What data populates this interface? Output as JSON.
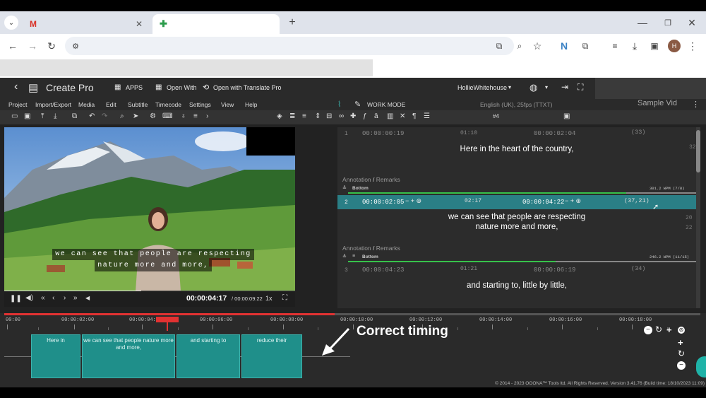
{
  "browser": {
    "tabs": [
      {
        "icon": "gmail-icon",
        "label": ""
      },
      {
        "icon": "ooona-icon",
        "label": ""
      }
    ],
    "new_tab": "+",
    "url": ""
  },
  "app": {
    "back": "‹",
    "title": "Create Pro",
    "apps_label": "APPS",
    "open_with_label": "Open With",
    "translate_label": "Open with Translate Pro",
    "user": "HollieWhitehouse",
    "work_mode": "WORK MODE",
    "format_info": "English (UK), 25fps (TTXT)",
    "sample_vid": "Sample Vid",
    "subtitle_counter": "#4",
    "menu": [
      "Project",
      "Import/Export",
      "Media",
      "Edit",
      "Subtitle",
      "Timecode",
      "Settings",
      "View",
      "Help"
    ]
  },
  "video": {
    "subtitle_line1": "we can see that people are respecting",
    "subtitle_line2": "nature more and more,",
    "current_time": "00:00:04:17",
    "duration": "/ 00:00:09:22",
    "speed": "1x",
    "progress": 0.47
  },
  "subtitles": [
    {
      "num": "1",
      "in": "00:00:00:19",
      "dur": "01:10",
      "out": "00:00:02:04",
      "chars": "(33)",
      "cps": "32",
      "text1": "Here in the heart of the country,",
      "text2": ""
    },
    {
      "num": "2",
      "in": "00:00:02:05",
      "dur": "02:17",
      "out": "00:00:04:22",
      "chars": "(37,21)",
      "cps": "20",
      "cps2": "22",
      "text1": "we can see that people are respecting",
      "text2": "nature more and more,"
    },
    {
      "num": "3",
      "in": "00:00:04:23",
      "dur": "01:21",
      "out": "00:00:06:19",
      "chars": "(34)",
      "cps": "",
      "text1": "and starting to, little by little,",
      "text2": ""
    }
  ],
  "annotation": {
    "label": "Annotation",
    "slash": "/",
    "remarks": "Remarks",
    "position": "Bottom",
    "wpm1": "301.2 WPM (7/8)",
    "wpm2": "246.2 WPM (11/15)"
  },
  "timeline": {
    "ticks": [
      "00:00",
      "00:00:02:00",
      "00:00:04:00",
      "00:00:06:00",
      "00:00:08:00",
      "00:00:10:00",
      "00:00:12:00",
      "00:00:14:00",
      "00:00:16:00",
      "00:00:18:00"
    ],
    "blocks": [
      {
        "text": "Here in"
      },
      {
        "text": "we can see that people nature more and more,"
      },
      {
        "text": "and starting to"
      },
      {
        "text": "reduce their"
      }
    ],
    "annotation_text": "Correct timing"
  },
  "footer": "© 2014 - 2023 OOONA™ Tools ltd. All Rights Reserved. Version 3.41.76 (Build time: 18/10/2023 11:09)",
  "colors": {
    "accent": "#1f8f8a",
    "playhead": "#e23232",
    "selected_row": "#2a7f86"
  }
}
